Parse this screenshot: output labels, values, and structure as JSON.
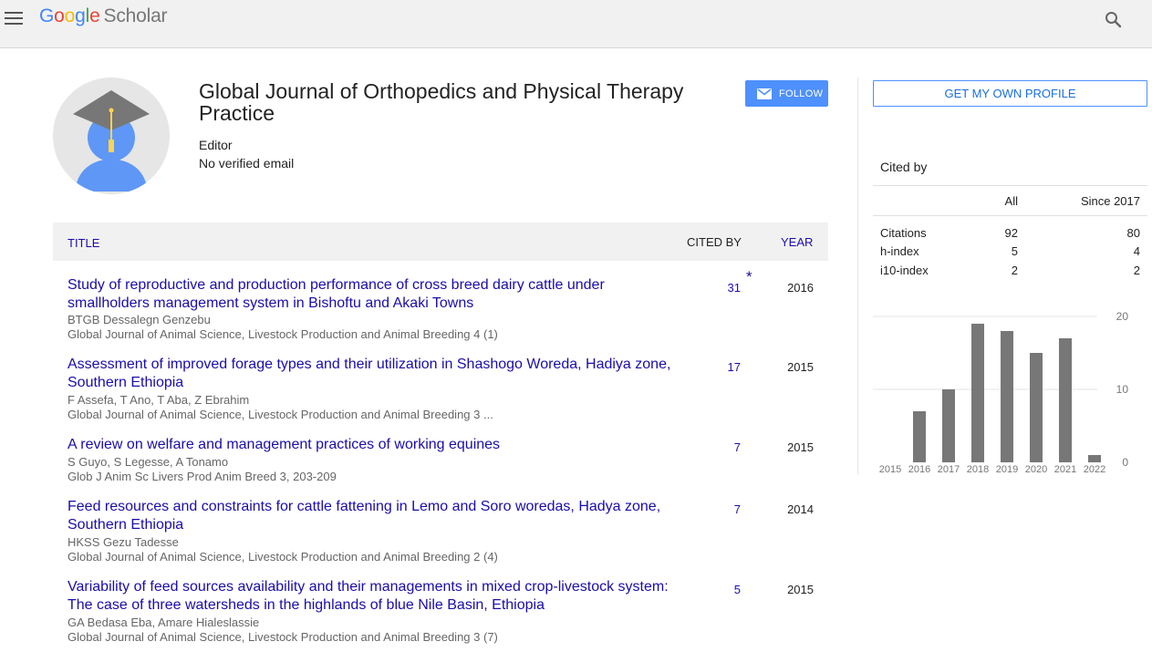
{
  "header": {
    "logo_letters": [
      "G",
      "o",
      "o",
      "g",
      "l",
      "e"
    ],
    "logo_product": "Scholar",
    "menu_icon": "hamburger-menu-icon",
    "search_icon": "search-icon"
  },
  "profile": {
    "name": "Global Journal of Orthopedics and Physical Therapy Practice",
    "role": "Editor",
    "email": "No verified email",
    "follow_label": "FOLLOW",
    "follow_icon": "mail-icon",
    "avatar_icon": "graduate-avatar-icon"
  },
  "table": {
    "col_title": "TITLE",
    "col_cited": "CITED BY",
    "col_year": "YEAR",
    "rows": [
      {
        "title": "Study of reproductive and production performance of cross breed dairy cattle under smallholders management system in Bishoftu and Akaki Towns",
        "authors": "BTGB Dessalegn Genzebu",
        "venue": "Global Journal of Animal Science, Livestock Production and Animal Breeding 4 (1)",
        "cited": "31",
        "star": "*",
        "year": "2016"
      },
      {
        "title": "Assessment of improved forage types and their utilization in Shashogo Woreda, Hadiya zone, Southern Ethiopia",
        "authors": "F Assefa, T Ano, T Aba, Z Ebrahim",
        "venue": "Global Journal of Animal Science, Livestock Production and Animal Breeding 3 ...",
        "cited": "17",
        "star": "",
        "year": "2015"
      },
      {
        "title": "A review on welfare and management practices of working equines",
        "authors": "S Guyo, S Legesse, A Tonamo",
        "venue": "Glob J Anim Sc Livers Prod Anim Breed 3, 203-209",
        "cited": "7",
        "star": "",
        "year": "2015"
      },
      {
        "title": "Feed resources and constraints for cattle fattening in Lemo and Soro woredas, Hadya zone, Southern Ethiopia",
        "authors": "HKSS Gezu Tadesse",
        "venue": "Global Journal of Animal Science, Livestock Production and Animal Breeding 2 (4)",
        "cited": "7",
        "star": "",
        "year": "2014"
      },
      {
        "title": "Variability of feed sources availability and their managements in mixed crop-livestock system: The case of three watersheds in the highlands of blue Nile Basin, Ethiopia",
        "authors": "GA Bedasa Eba, Amare Hialeslassie",
        "venue": "Global Journal of Animal Science, Livestock Production and Animal Breeding 3 (7)",
        "cited": "5",
        "star": "",
        "year": "2015"
      }
    ]
  },
  "sidebar": {
    "get_profile_label": "GET MY OWN PROFILE",
    "cited_by_heading": "Cited by",
    "col_all": "All",
    "col_since": "Since 2017",
    "stats": [
      {
        "label": "Citations",
        "all": "92",
        "since": "80"
      },
      {
        "label": "h-index",
        "all": "5",
        "since": "4"
      },
      {
        "label": "i10-index",
        "all": "2",
        "since": "2"
      }
    ]
  },
  "chart_data": {
    "type": "bar",
    "categories": [
      "2015",
      "2016",
      "2017",
      "2018",
      "2019",
      "2020",
      "2021",
      "2022"
    ],
    "values": [
      0,
      7,
      10,
      19,
      18,
      15,
      17,
      1
    ],
    "yticks": [
      "0",
      "10",
      "20"
    ],
    "ylim": [
      0,
      20
    ],
    "grid": true,
    "bar_color": "#777777"
  },
  "colors": {
    "link": "#1a0dab",
    "accent": "#4d90fe",
    "header_bg": "#f1f1f1"
  }
}
